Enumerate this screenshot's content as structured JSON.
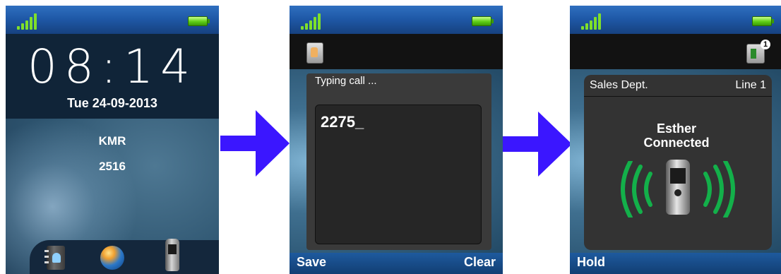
{
  "screen1": {
    "time": "08:14",
    "date": "Tue 24-09-2013",
    "user_name": "KMR",
    "extension": "2516",
    "icons": [
      "phonebook-icon",
      "globe-icon",
      "handset-icon"
    ]
  },
  "screen2": {
    "title": "Typing call ...",
    "dialed_number": "2275_",
    "softkeys": {
      "left": "Save",
      "right": "Clear"
    }
  },
  "screen3": {
    "line_name": "Sales Dept.",
    "line_label": "Line 1",
    "caller": "Esther",
    "status": "Connected",
    "transfer_badge": "1",
    "softkeys": {
      "left": "Hold"
    }
  },
  "colors": {
    "arrow": "#3b16ff",
    "status_bar": "#1f59a8",
    "softkey_bar": "#123e73",
    "signal": "#7fe02a",
    "call_waves": "#13b04a"
  }
}
